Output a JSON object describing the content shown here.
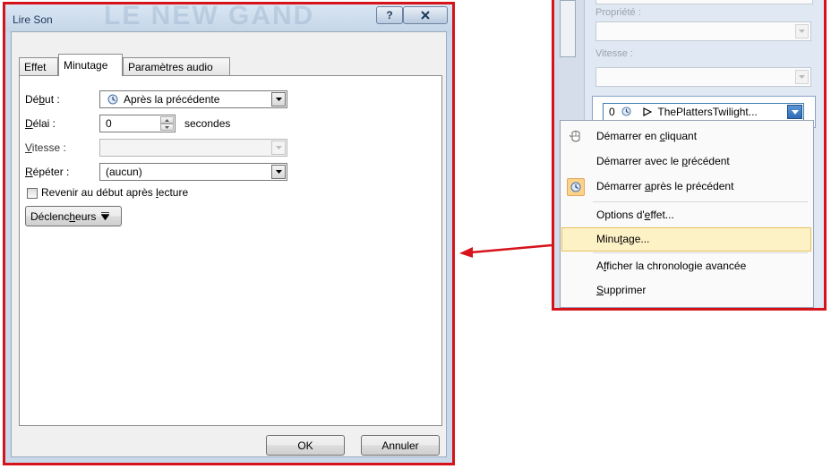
{
  "dialog": {
    "title": "Lire Son",
    "title_ghost": "LE NEW GAND",
    "help_label": "?",
    "tabs": [
      {
        "label": "Effet"
      },
      {
        "label": "Minutage"
      },
      {
        "label": "Paramètres audio"
      }
    ],
    "start": {
      "label_pre": "Dé",
      "label_u": "b",
      "label_post": "ut :",
      "value": "Après la précédente",
      "icon": "clock-icon"
    },
    "delay": {
      "label_u": "D",
      "label_post": "élai :",
      "value": "0",
      "unit": "secondes"
    },
    "speed": {
      "label_u": "V",
      "label_post": "itesse :",
      "value": ""
    },
    "repeat": {
      "label_u": "R",
      "label_post": "épéter :",
      "value": "(aucun)"
    },
    "rewind": {
      "label_pre": "Revenir au début après ",
      "label_u": "l",
      "label_post": "ecture",
      "checked": false
    },
    "triggers": {
      "label_pre": "Déclenc",
      "label_u": "h",
      "label_post": "eurs"
    },
    "ok_label": "OK",
    "cancel_label": "Annuler"
  },
  "pane": {
    "property_label": "Propriété :",
    "speed_label": "Vitesse :",
    "animation": {
      "order": "0",
      "name": "ThePlattersTwilight..."
    }
  },
  "context_menu": {
    "items": [
      {
        "pre": "Démarrer en ",
        "u": "c",
        "post": "liquant",
        "icon": "mouse-icon"
      },
      {
        "pre": "Démarrer avec le ",
        "u": "p",
        "post": "récédent",
        "icon": ""
      },
      {
        "pre": "Démarrer ",
        "u": "a",
        "post": "près le précédent",
        "icon": "clock-icon",
        "checked": true
      },
      {
        "pre": "Options d'",
        "u": "e",
        "post": "ffet...",
        "icon": ""
      },
      {
        "pre": "Minu",
        "u": "t",
        "post": "age...",
        "icon": "",
        "highlighted": true
      },
      {
        "pre": "A",
        "u": "f",
        "post": "ficher la chronologie avancée",
        "icon": ""
      },
      {
        "pre": "",
        "u": "S",
        "post": "upprimer",
        "icon": ""
      }
    ]
  },
  "colors": {
    "highlight_border": "#d6121b",
    "menu_hover": "#fdf1c6",
    "accent": "#2e6bb5"
  }
}
